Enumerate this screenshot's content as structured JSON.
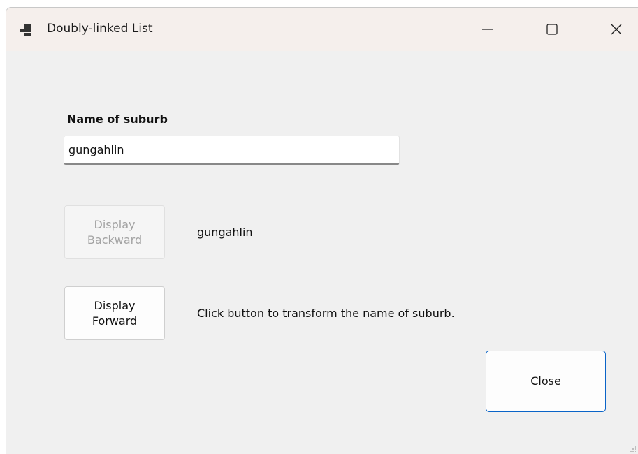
{
  "window": {
    "title": "Doubly-linked List",
    "icon": "app-window-icon",
    "controls": {
      "minimize_icon": "minimize-icon",
      "maximize_icon": "maximize-icon",
      "close_icon": "close-icon"
    }
  },
  "form": {
    "field_label": "Name of suburb",
    "input_value": "gungahlin",
    "display_backward_label": "Display\nBackward",
    "display_backward_enabled": false,
    "output_text": "gungahlin",
    "display_forward_label": "Display\nForward",
    "instruction_text": "Click button to transform the name of suburb.",
    "close_label": "Close"
  },
  "colors": {
    "titlebar_bg": "#f5efec",
    "window_bg": "#f0f0f0",
    "focus_border": "#0a64c8",
    "disabled_text": "#a3a3a3"
  }
}
